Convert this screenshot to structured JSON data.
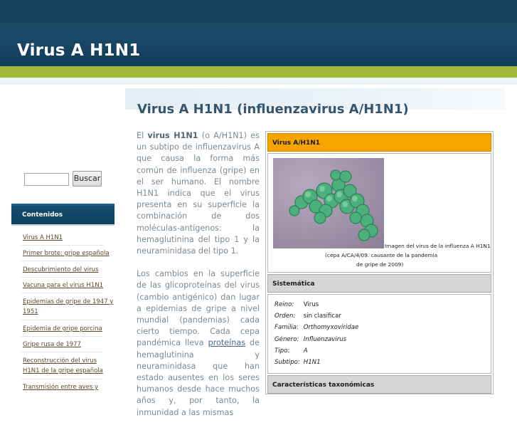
{
  "site": {
    "title": "Virus A H1N1"
  },
  "search": {
    "button_label": "Buscar",
    "value": ""
  },
  "sidebar": {
    "menu_title": "Contenidos",
    "items": [
      {
        "label": "Virus A H1N1"
      },
      {
        "label": "Primer brote: gripe española"
      },
      {
        "label": "Descubrimiento del virus"
      },
      {
        "label": "Vacuna para el virus H1N1"
      },
      {
        "label_line1": "Epidemias de gripe de 1947 y",
        "label_line2": "1951"
      },
      {
        "label": "Epidemia de gripe porcina"
      },
      {
        "label": "Gripe rusa de 1977"
      },
      {
        "label_line1": "Reconstrucción del virus",
        "label_line2": "H1N1 de la gripe española"
      },
      {
        "label": "Transmisión entre aves y"
      }
    ]
  },
  "main": {
    "page_title": "Virus A H1N1 (influenzavirus A/H1N1)",
    "para1_a": "El ",
    "para1_bold": "virus H1N1",
    "para1_b": " (o A/H1N1) es un subtipo de influenzavirus A que causa la forma más común de influenza (gripe) en el ser humano. El nombre H1N1 indica que el virus presenta en su superficie la combinación de dos moléculas-antígenos: la hemaglutinina del tipo 1 y la neuraminidasa del tipo 1.",
    "para2_a": "Los cambios en la superficie de las glicoproteínas del virus (cambio antigénico) dan lugar a epidemias de gripe a nivel mundial (pandemias) cada cierto tiempo. Cada cepa pandémica lleva ",
    "para2_link": "proteínas",
    "para2_b": " de hemaglutinina y neuraminidasa que han estado ausentes en los seres humanos desde hace muchos años y, por tanto, la inmunidad a las mismas"
  },
  "infobox": {
    "title": "Virus A/H1N1",
    "caption_line1": "Imagen del virus de la influenza A H1N1",
    "caption_line2": "(cepa A/CA/4/09. causante de la pandemia",
    "caption_line3": "de gripe de 2009)",
    "section_taxonomy": "Sistemática",
    "taxonomy": [
      {
        "key": "Reino:",
        "value": "Virus",
        "italic": false
      },
      {
        "key": "Orden:",
        "value": "sin clasificar",
        "italic": false
      },
      {
        "key": "Familia:",
        "value": "Orthomyxoviridae",
        "italic": true
      },
      {
        "key": "Género:",
        "value": "Influenzavirus",
        "italic": true
      },
      {
        "key": "Tipo:",
        "value": "A",
        "italic": true
      },
      {
        "key": "Subtipo:",
        "value": "H1N1",
        "italic": true
      }
    ],
    "section_characteristics": "Características taxonómicas"
  },
  "colors": {
    "header_blue": "#1a4a68",
    "green_band": "#a2b83a",
    "infobox_orange": "#f7a400",
    "menu_dark_blue": "#0f3f5e",
    "virus_green": "#4fb07a"
  },
  "icons": {}
}
